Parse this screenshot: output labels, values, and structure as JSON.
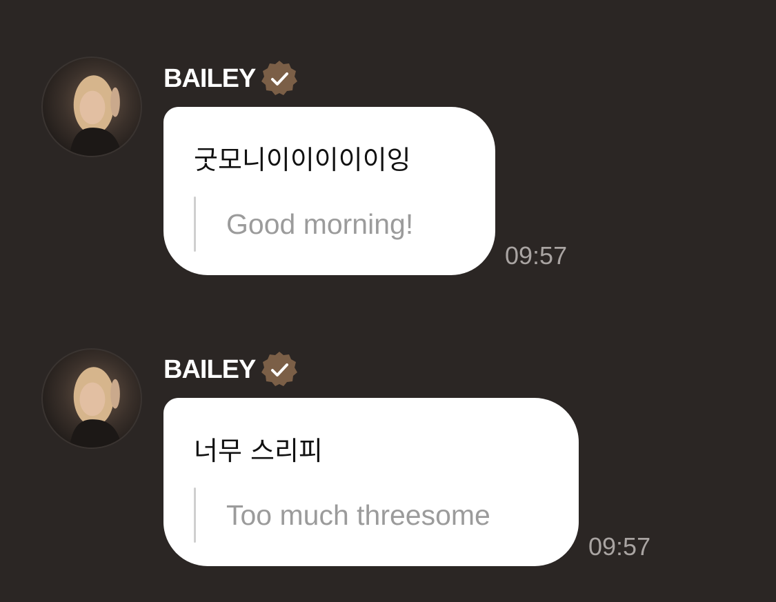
{
  "colors": {
    "background": "#2b2624",
    "bubble": "#ffffff",
    "verified_badge": "#7b5f47",
    "translation_text": "#9b9b9b",
    "timestamp_text": "#a9a4a2"
  },
  "messages": [
    {
      "sender": "BAILEY",
      "verified": true,
      "avatar_icon": "profile-photo",
      "original": "굿모니이이이이이잉",
      "translation": "Good morning!",
      "time": "09:57"
    },
    {
      "sender": "BAILEY",
      "verified": true,
      "avatar_icon": "profile-photo",
      "original": "너무 스리피",
      "translation": "Too much threesome",
      "time": "09:57"
    }
  ]
}
